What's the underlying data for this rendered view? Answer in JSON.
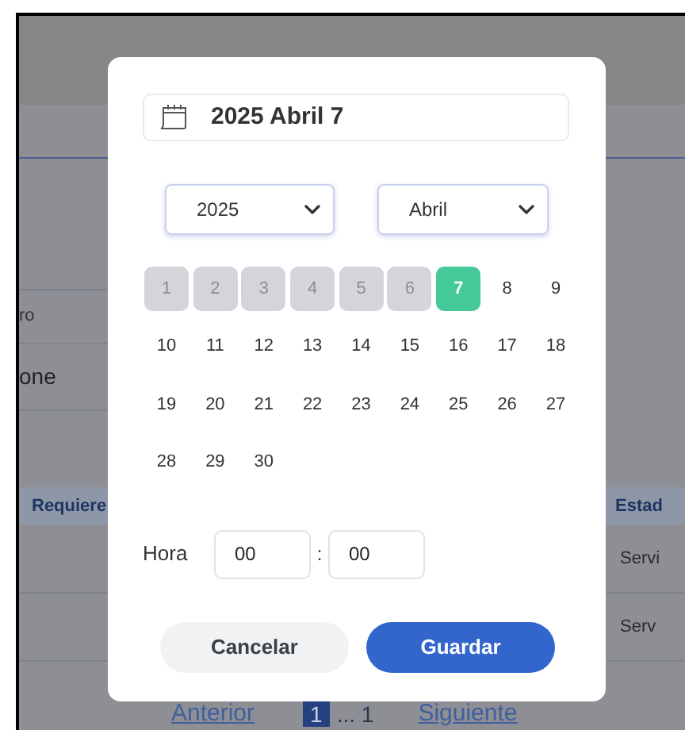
{
  "background": {
    "label_1": "ro",
    "value_1": "one",
    "table": {
      "columns": [
        "Requiere",
        "Estad"
      ],
      "rows": [
        {
          "cells": [
            "Servi"
          ]
        },
        {
          "cells": [
            "Serv"
          ]
        }
      ]
    },
    "pagination": {
      "previous": "Anterior",
      "current": "1",
      "ellipsis": "... 1",
      "next": "Siguiente"
    }
  },
  "dialog": {
    "date_field": {
      "value": "2025 Abril 7"
    },
    "year_select": {
      "value": "2025"
    },
    "month_select": {
      "value": "Abril"
    },
    "days": [
      {
        "label": "1",
        "disabled": true,
        "selected": false
      },
      {
        "label": "2",
        "disabled": true,
        "selected": false
      },
      {
        "label": "3",
        "disabled": true,
        "selected": false
      },
      {
        "label": "4",
        "disabled": true,
        "selected": false
      },
      {
        "label": "5",
        "disabled": true,
        "selected": false
      },
      {
        "label": "6",
        "disabled": true,
        "selected": false
      },
      {
        "label": "7",
        "disabled": false,
        "selected": true
      },
      {
        "label": "8",
        "disabled": false,
        "selected": false
      },
      {
        "label": "9",
        "disabled": false,
        "selected": false
      },
      {
        "label": "10",
        "disabled": false,
        "selected": false
      },
      {
        "label": "11",
        "disabled": false,
        "selected": false
      },
      {
        "label": "12",
        "disabled": false,
        "selected": false
      },
      {
        "label": "13",
        "disabled": false,
        "selected": false
      },
      {
        "label": "14",
        "disabled": false,
        "selected": false
      },
      {
        "label": "15",
        "disabled": false,
        "selected": false
      },
      {
        "label": "16",
        "disabled": false,
        "selected": false
      },
      {
        "label": "17",
        "disabled": false,
        "selected": false
      },
      {
        "label": "18",
        "disabled": false,
        "selected": false
      },
      {
        "label": "19",
        "disabled": false,
        "selected": false
      },
      {
        "label": "20",
        "disabled": false,
        "selected": false
      },
      {
        "label": "21",
        "disabled": false,
        "selected": false
      },
      {
        "label": "22",
        "disabled": false,
        "selected": false
      },
      {
        "label": "23",
        "disabled": false,
        "selected": false
      },
      {
        "label": "24",
        "disabled": false,
        "selected": false
      },
      {
        "label": "25",
        "disabled": false,
        "selected": false
      },
      {
        "label": "26",
        "disabled": false,
        "selected": false
      },
      {
        "label": "27",
        "disabled": false,
        "selected": false
      },
      {
        "label": "28",
        "disabled": false,
        "selected": false
      },
      {
        "label": "29",
        "disabled": false,
        "selected": false
      },
      {
        "label": "30",
        "disabled": false,
        "selected": false
      }
    ],
    "time": {
      "label": "Hora",
      "hours": "00",
      "separator": ":",
      "minutes": "00"
    },
    "buttons": [
      {
        "label": "Cancelar",
        "kind": "secondary"
      },
      {
        "label": "Guardar",
        "kind": "primary"
      }
    ]
  }
}
